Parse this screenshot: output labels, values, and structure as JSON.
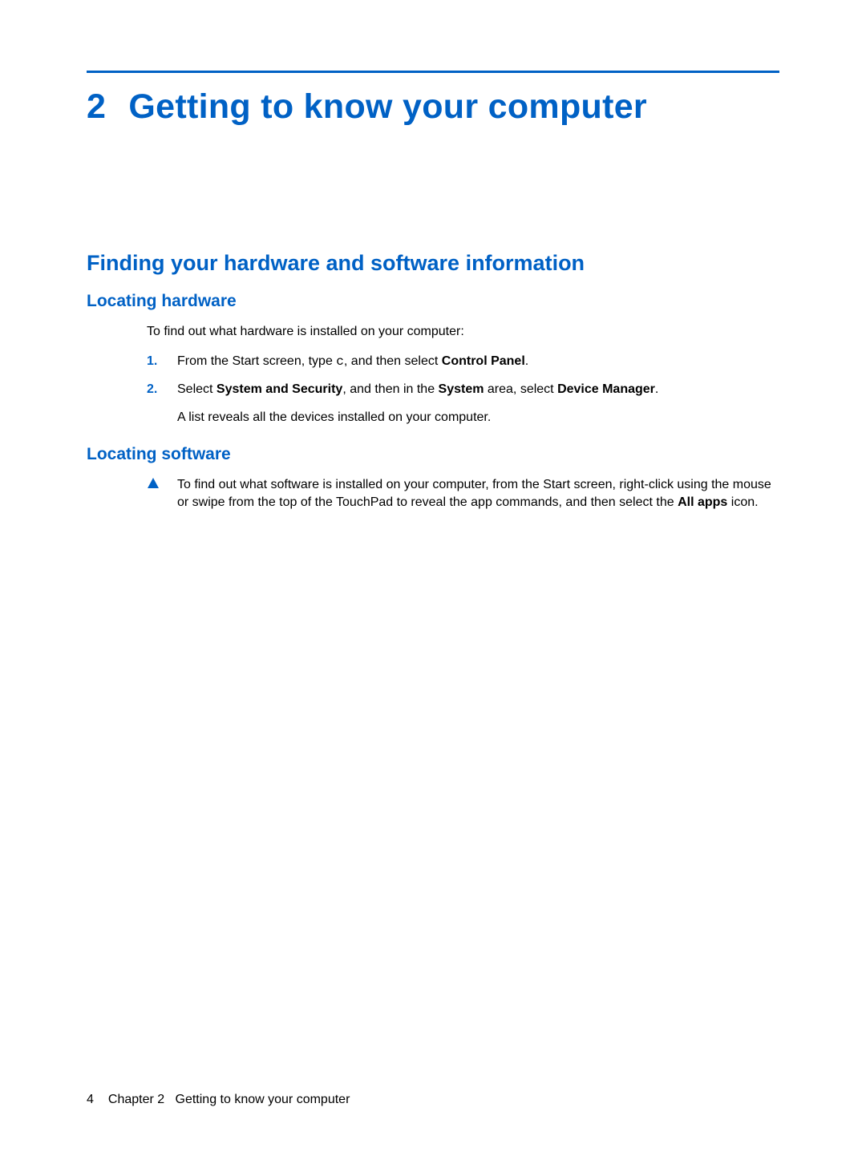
{
  "chapter": {
    "num": "2",
    "title": "Getting to know your computer"
  },
  "h2": "Finding your hardware and software information",
  "section1": {
    "heading": "Locating hardware",
    "intro": "To find out what hardware is installed on your computer:",
    "steps": [
      {
        "marker": "1.",
        "pre": "From the Start screen, type ",
        "mono": "c",
        "mid": ", and then select ",
        "bold": "Control Panel",
        "post": "."
      },
      {
        "marker": "2.",
        "pre": "Select ",
        "bold1": "System and Security",
        "mid1": ", and then in the ",
        "bold2": "System",
        "mid2": " area, select ",
        "bold3": "Device Manager",
        "post": ".",
        "sub": "A list reveals all the devices installed on your computer."
      }
    ]
  },
  "section2": {
    "heading": "Locating software",
    "note": {
      "pre": "To find out what software is installed on your computer, from the Start screen, right-click using the mouse or swipe from the top of the TouchPad to reveal the app commands, and then select the ",
      "bold": "All apps",
      "post": " icon."
    }
  },
  "footer": {
    "page": "4",
    "chapter_label": "Chapter 2",
    "chapter_title": "Getting to know your computer"
  }
}
